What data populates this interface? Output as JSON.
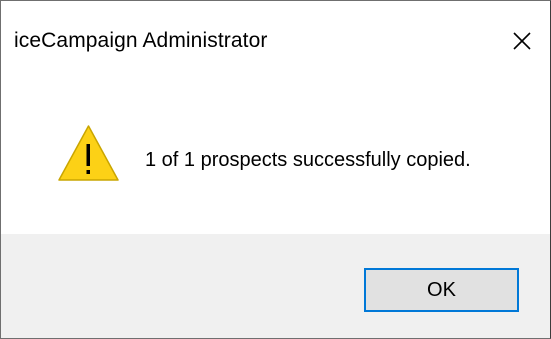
{
  "window": {
    "title": "iceCampaign Administrator",
    "close_icon": "close-icon"
  },
  "content": {
    "icon": "warning-icon",
    "message": "1 of 1 prospects successfully copied."
  },
  "footer": {
    "ok_label": "OK"
  },
  "colors": {
    "warning_fill": "#fcd116",
    "button_border_focus": "#0078d7",
    "footer_bg": "#f0f0f0"
  }
}
